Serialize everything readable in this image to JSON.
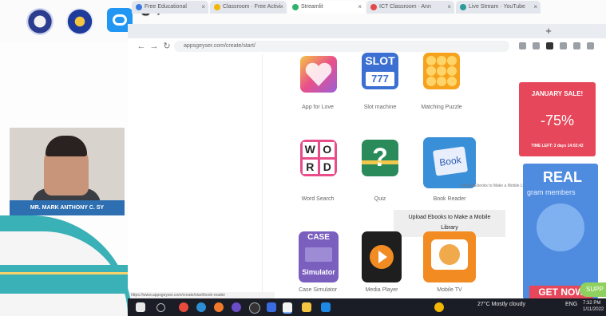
{
  "slide": {
    "heading_fragment": "g                      ,",
    "presenter_name": "MR. MARK ANTHONY C. SY"
  },
  "browser": {
    "tabs": [
      {
        "label": "Free Educational",
        "active": false
      },
      {
        "label": "Classroom · Free Activi",
        "active": false
      },
      {
        "label": "Streamlit",
        "active": true
      },
      {
        "label": "ICT Classroom · Ann",
        "active": false
      },
      {
        "label": "Live Stream · YouTube",
        "active": false
      }
    ],
    "new_tab": "+",
    "url": "appsgeyser.com/create/start/",
    "nav": {
      "back": "←",
      "forward": "→",
      "reload": "↻"
    }
  },
  "apps": [
    {
      "label": "App for Love",
      "tile_text": "",
      "color": "#f4b54a"
    },
    {
      "label": "Slot machine",
      "tile_text": "SLOT",
      "color": "#3b6fd1"
    },
    {
      "label": "Matching Puzzle",
      "tile_text": "",
      "color": "#f7a21c"
    },
    {
      "label": "Word Search",
      "tile_text": "WORD",
      "color": "#e84d8a"
    },
    {
      "label": "Quiz",
      "tile_text": "?",
      "color": "#2a8a5a"
    },
    {
      "label": "Book Reader",
      "tile_text": "Book",
      "color": "#3a8fd9"
    },
    {
      "label": "Case Simulator",
      "tile_text": "CASE",
      "color": "#7a5fbf"
    },
    {
      "label": "Media Player",
      "tile_text": "",
      "color": "#1e1e1e"
    },
    {
      "label": "Mobile TV",
      "tile_text": "",
      "color": "#f28b22"
    }
  ],
  "slot_digits": "777",
  "case_sub": "Simulator",
  "tooltip": {
    "line1": "Upload Ebooks to Make a Mobile",
    "line2": "Library"
  },
  "book_hint": "Upload Ebooks to Make a Mobile Library",
  "promo": {
    "sale_title": "JANUARY SALE!",
    "sale_pct": "-75%",
    "sale_timer": "TIME LEFT: 3 days 14:02:42",
    "real_title": "REAL",
    "real_sub": "gram members",
    "real_button": "GET NOW",
    "support": "SUPP"
  },
  "status_url": "https://www.appsgeyser.com/create/start/book-reader",
  "taskbar": {
    "weather": "27°C  Mostly cloudy",
    "lang": "ENG",
    "clock_line1": "7:32 PM",
    "clock_line2": "1/11/2022"
  }
}
